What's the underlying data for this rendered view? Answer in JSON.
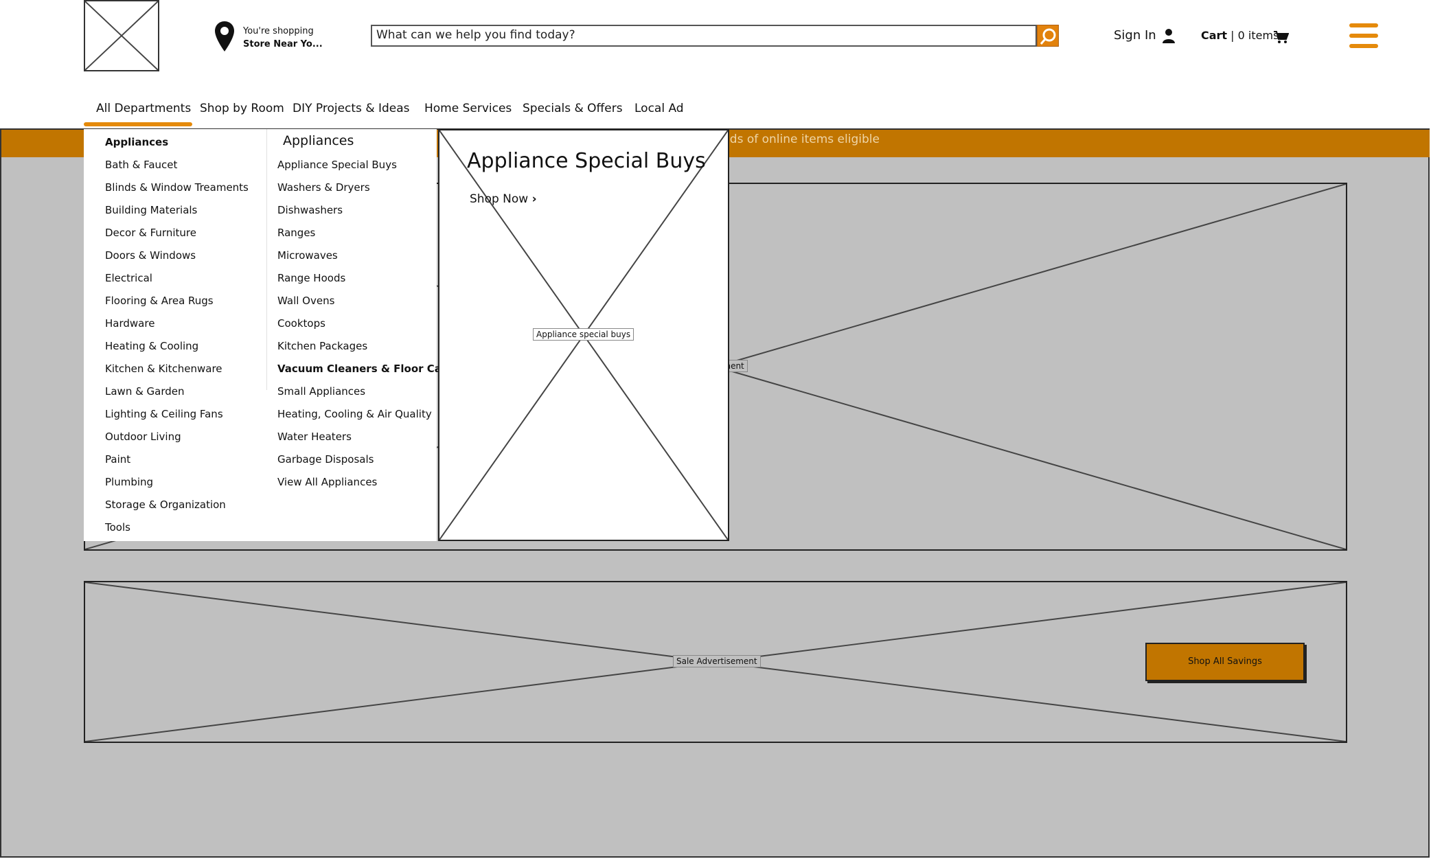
{
  "header": {
    "store_line1": "You're shopping",
    "store_line2": "Store Near Yo...",
    "search_placeholder": "What can we help you find today?",
    "sign_in": "Sign In",
    "cart_label": "Cart",
    "cart_sep": "|",
    "cart_count": "0 items",
    "accent_color": "#e58a0b"
  },
  "nav": {
    "items": [
      "All Departments",
      "Shop by Room",
      "DIY Projects & Ideas",
      "Home Services",
      "Specials & Offers",
      "Local Ad"
    ]
  },
  "promo": {
    "text": "nds of online items eligible",
    "bar_color": "#c17500"
  },
  "mega_menu": {
    "departments": [
      "Appliances",
      "Bath & Faucet",
      "Blinds & Window Treaments",
      "Building Materials",
      "Decor & Furniture",
      "Doors & Windows",
      "Electrical",
      "Flooring & Area Rugs",
      "Hardware",
      "Heating & Cooling",
      "Kitchen & Kitchenware",
      "Lawn & Garden",
      "Lighting & Ceiling Fans",
      "Outdoor Living",
      "Paint",
      "Plumbing",
      "Storage & Organization",
      "Tools"
    ],
    "sub_heading": "Appliances",
    "subcategories": [
      "Appliance Special Buys",
      "Washers & Dryers",
      "Dishwashers",
      "Ranges",
      "Microwaves",
      "Range Hoods",
      "Wall Ovens",
      "Cooktops",
      "Kitchen Packages",
      "Vacuum Cleaners & Floor Care",
      "Small Appliances",
      "Heating, Cooling & Air Quality",
      "Water Heaters",
      "Garbage Disposals",
      "View All Appliances"
    ]
  },
  "specials_panel": {
    "title": "Appliance Special Buys",
    "shop_now": "Shop Now",
    "image_label": "Appliance special buys"
  },
  "hero": {
    "label": "ement"
  },
  "sale": {
    "label": "Sale Advertisement",
    "button": "Shop All Savings"
  }
}
